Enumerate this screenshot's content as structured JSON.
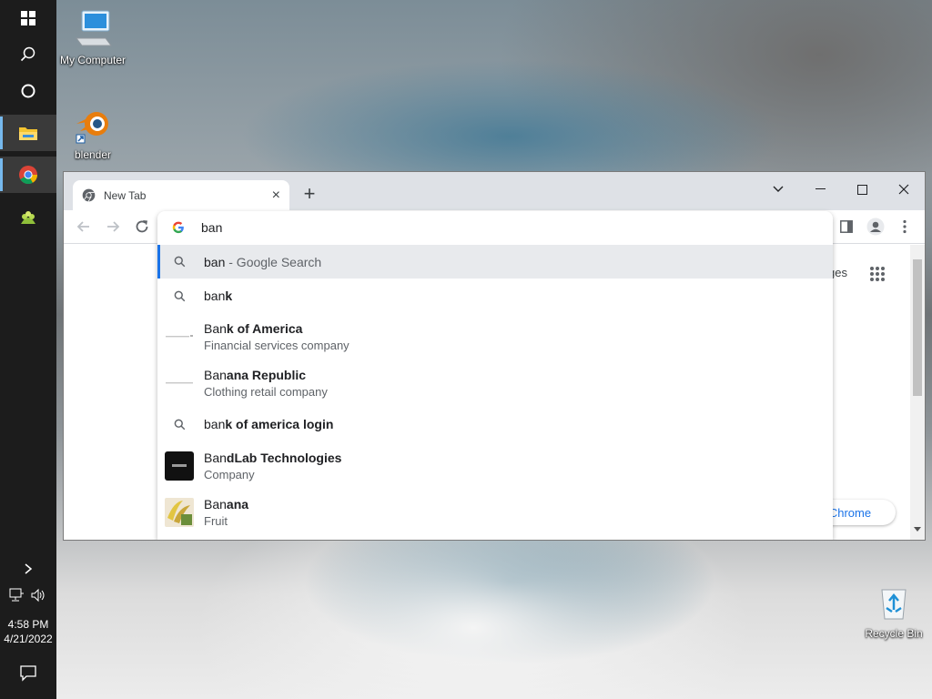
{
  "desktop": {
    "icons": [
      {
        "label": "My Computer",
        "icon": "computer-icon"
      },
      {
        "label": "blender",
        "icon": "blender-icon"
      },
      {
        "label": "Recycle Bin",
        "icon": "recycle-bin-icon"
      }
    ]
  },
  "taskbar": {
    "time": "4:58 PM",
    "date": "4/21/2022",
    "items": [
      "start-icon",
      "search-icon",
      "cortana-icon",
      "file-explorer-icon",
      "chrome-icon",
      "app-icon"
    ]
  },
  "browser": {
    "tab_title": "New Tab",
    "tab_close": "×",
    "new_tab": "+",
    "page_fragment_images": "ges",
    "page_fragment_customize": "e Chrome",
    "omnibox": {
      "value": "ban",
      "suggestions": [
        {
          "type": "search",
          "prefix": "ban",
          "bold": "",
          "suffix": " - Google Search",
          "selected": true
        },
        {
          "type": "search",
          "prefix": "ban",
          "bold": "k",
          "suffix": ""
        },
        {
          "type": "entity",
          "prefix": "Ban",
          "bold": "k of America",
          "sub": "Financial services company"
        },
        {
          "type": "entity",
          "prefix": "Ban",
          "bold": "ana Republic",
          "sub": "Clothing retail company"
        },
        {
          "type": "search",
          "prefix": "ban",
          "bold": "k of america login",
          "suffix": ""
        },
        {
          "type": "entity",
          "prefix": "Ban",
          "bold": "dLab Technologies",
          "sub": "Company"
        },
        {
          "type": "entity",
          "prefix": "Ban",
          "bold": "ana",
          "sub": "Fruit"
        }
      ]
    }
  },
  "colors": {
    "taskbar": "#1c1c1c",
    "accent": "#1a73e8",
    "selected_row": "#e8eaed"
  }
}
